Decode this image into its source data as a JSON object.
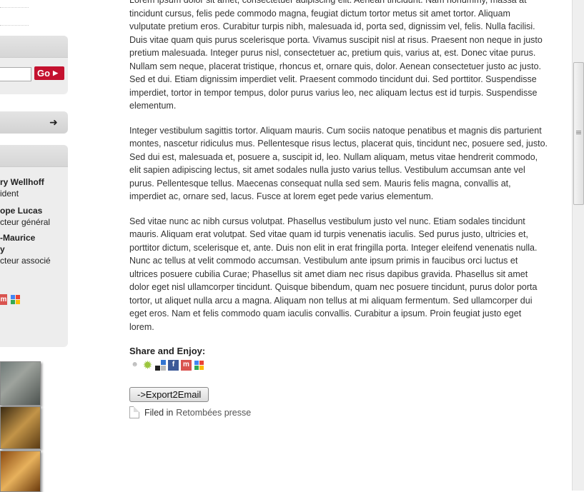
{
  "sidebar": {
    "search_button": "Go",
    "team": [
      {
        "name": "ry Wellhoff",
        "role": "ident"
      },
      {
        "name": "ope Lucas",
        "role": "cteur général"
      },
      {
        "name": "-Maurice",
        "name2": "y",
        "role": "cteur associé"
      }
    ]
  },
  "article": {
    "paragraphs": [
      "Lorem ipsum dolor sit amet, consectetuer adipiscing elit. Aenean tincidunt. Nam nonummy, massa at tincidunt cursus, felis pede commodo magna, feugiat dictum tortor metus sit amet tortor. Aliquam vulputate pretium eros. Curabitur turpis nibh, malesuada id, porta sed, dignissim vel, felis. Nulla facilisi. Duis vitae quam quis purus scelerisque porta. Vivamus suscipit nisl at risus. Praesent non neque in justo pretium malesuada. Integer purus nisl, consectetuer ac, pretium quis, varius at, est. Donec vitae purus. Nullam sem neque, placerat tristique, rhoncus et, ornare quis, dolor. Aenean consectetuer justo ac justo. Sed et dui. Etiam dignissim imperdiet velit. Praesent commodo tincidunt dui. Sed porttitor. Suspendisse imperdiet, tortor in tempor tempus, dolor purus varius leo, nec aliquam lectus est id turpis. Suspendisse elementum.",
      "Integer vestibulum sagittis tortor. Aliquam mauris. Cum sociis natoque penatibus et magnis dis parturient montes, nascetur ridiculus mus. Pellentesque risus lectus, placerat quis, tincidunt nec, posuere sed, justo. Sed dui est, malesuada et, posuere a, suscipit id, leo. Nullam aliquam, metus vitae hendrerit commodo, elit sapien adipiscing lectus, sit amet sodales nulla justo varius tellus. Vestibulum accumsan ante vel purus. Pellentesque tellus. Maecenas consequat nulla sed sem. Mauris felis magna, convallis at, imperdiet ac, ornare sed, lacus. Fusce at lorem eget pede varius elementum.",
      "Sed vitae nunc ac nibh cursus volutpat. Phasellus vestibulum justo vel nunc. Etiam sodales tincidunt mauris. Aliquam erat volutpat. Sed vitae quam id turpis venenatis iaculis. Sed purus justo, ultricies et, porttitor dictum, scelerisque et, ante. Duis non elit in erat fringilla porta. Integer eleifend venenatis nulla. Nunc ac tellus at velit commodo accumsan. Vestibulum ante ipsum primis in faucibus orci luctus et ultrices posuere cubilia Curae; Phasellus sit amet diam nec risus dapibus gravida. Phasellus sit amet dolor eget nisl ullamcorper tincidunt. Quisque bibendum, quam nec posuere tincidunt, purus dolor porta tortor, ut aliquet nulla arcu a magna. Aliquam non tellus at mi aliquam fermentum. Sed ullamcorper dui eget eros. Nam et felis commodo quam iaculis convallis. Curabitur a ipsum. Proin feugiat justo eget lorem."
    ],
    "share_title": "Share and Enjoy:",
    "share_icons": [
      "digg-icon",
      "stumbleupon-icon",
      "delicious-icon",
      "facebook-icon",
      "mixx-icon",
      "google-bookmarks-icon"
    ],
    "export_button": "->Export2Email",
    "filed_prefix": "Filed in",
    "filed_category": "Retombées presse"
  },
  "colors": {
    "go_button": "#c4122f",
    "text": "#333333"
  }
}
